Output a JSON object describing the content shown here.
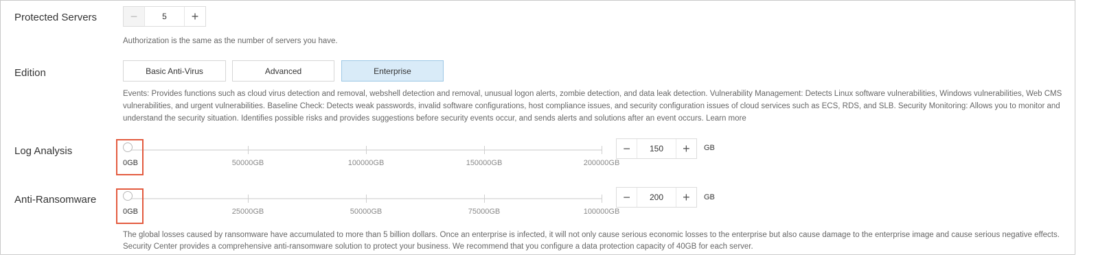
{
  "protected_servers": {
    "label": "Protected Servers",
    "minus": "−",
    "value": "5",
    "plus": "+",
    "help": "Authorization is the same as the number of servers you have."
  },
  "edition": {
    "label": "Edition",
    "options": [
      "Basic Anti-Virus",
      "Advanced",
      "Enterprise"
    ],
    "selected": "Enterprise",
    "help_line1": "Events: Provides functions such as cloud virus detection and removal, webshell detection and removal, unusual logon alerts, zombie detection, and data leak detection. Vulnerability Management: Detects Linux software vulnerabilities, Windows vulnerabilities, Web CMS",
    "help_line2": "vulnerabilities, and urgent vulnerabilities. Baseline Check: Detects weak passwords, invalid software configurations, host compliance issues, and security configuration issues of cloud services such as ECS, RDS, and SLB. Security Monitoring: Allows you to monitor and",
    "help_line3": "understand the security situation. Identifies possible risks and provides suggestions before security events occur, and sends alerts and solutions after an event occurs.",
    "learn_more": "Learn more"
  },
  "log_analysis": {
    "label": "Log Analysis",
    "ticks": [
      "0GB",
      "50000GB",
      "100000GB",
      "150000GB",
      "200000GB"
    ],
    "minus": "−",
    "value": "150",
    "plus": "+",
    "unit": "GB"
  },
  "anti_ransomware": {
    "label": "Anti-Ransomware",
    "ticks": [
      "0GB",
      "25000GB",
      "50000GB",
      "75000GB",
      "100000GB"
    ],
    "minus": "−",
    "value": "200",
    "plus": "+",
    "unit": "GB",
    "help_line1": "The global losses caused by ransomware have accumulated to more than 5 billion dollars. Once an enterprise is infected, it will not only cause serious economic losses to the enterprise but also cause damage to the enterprise image and cause serious negative effects.",
    "help_line2": "Security Center provides a comprehensive anti-ransomware solution to protect your business. We recommend that you configure a data protection capacity of 40GB for each server."
  },
  "colors": {
    "selected_bg": "#d9ebf8",
    "highlight": "#e35a3e"
  }
}
